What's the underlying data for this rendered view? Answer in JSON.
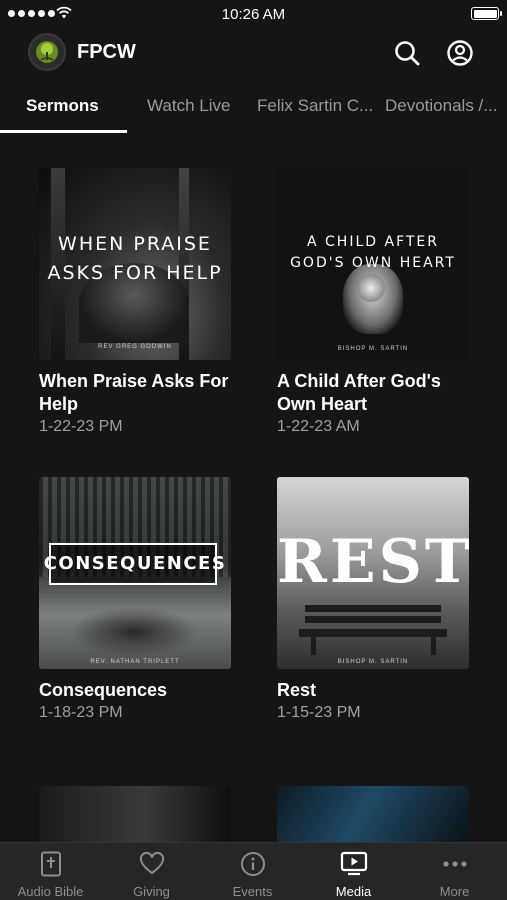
{
  "status_bar": {
    "time": "10:26 AM"
  },
  "header": {
    "app_name": "FPCW",
    "logo_icon": "tree-logo-icon",
    "actions": [
      "search-icon",
      "account-icon"
    ]
  },
  "tabs": [
    {
      "label": "Sermons",
      "active": true
    },
    {
      "label": "Watch Live",
      "active": false
    },
    {
      "label": "Felix Sartin C...",
      "active": false
    },
    {
      "label": "Devotionals /...",
      "active": false
    }
  ],
  "sermons": [
    {
      "title": "When Praise Asks For Help",
      "date": "1-22-23 PM",
      "art_title_lines": [
        "WHEN PRAISE",
        "ASKS FOR HELP"
      ],
      "art_caption": "REV GREG GODWIN"
    },
    {
      "title": "A Child After God's Own Heart",
      "date": "1-22-23 AM",
      "art_title_lines": [
        "A CHILD AFTER",
        "GOD'S OWN HEART"
      ],
      "art_caption": "BISHOP M. SARTIN"
    },
    {
      "title": "Consequences",
      "date": "1-18-23 PM",
      "art_title_lines": [
        "CONSEQUENCES"
      ],
      "art_caption": "REV. NATHAN TRIPLETT"
    },
    {
      "title": "Rest",
      "date": "1-15-23 PM",
      "art_title_lines": [
        "REST"
      ],
      "art_caption": "BISHOP M. SARTIN"
    }
  ],
  "bottom_nav": [
    {
      "label": "Audio Bible",
      "icon": "bible-icon",
      "active": false
    },
    {
      "label": "Giving",
      "icon": "heart-icon",
      "active": false
    },
    {
      "label": "Events",
      "icon": "info-icon",
      "active": false
    },
    {
      "label": "Media",
      "icon": "tv-play-icon",
      "active": true
    },
    {
      "label": "More",
      "icon": "more-dots-icon",
      "active": false
    }
  ]
}
